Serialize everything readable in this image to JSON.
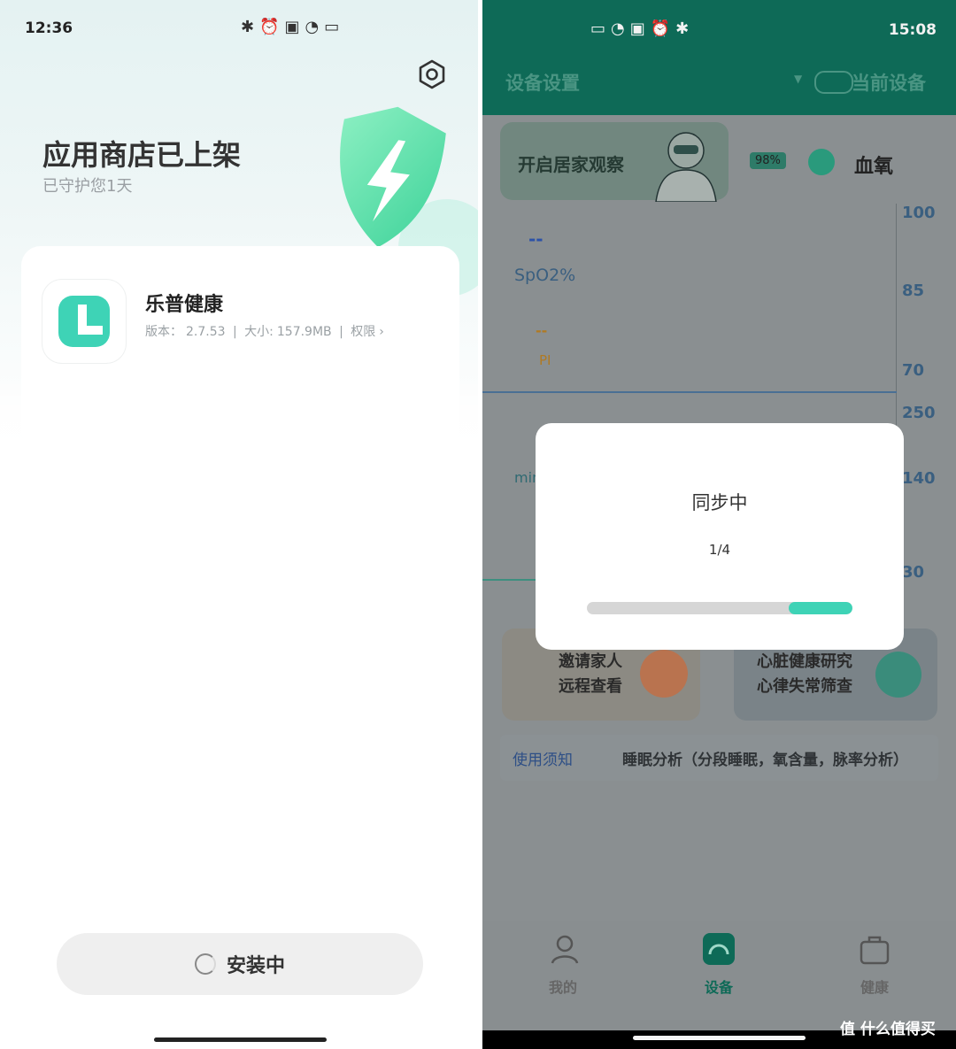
{
  "left": {
    "status_bar": {
      "time": "12:36",
      "icons": [
        "bluetooth-icon",
        "alarm-icon",
        "nfc-icon",
        "wifi-icon",
        "battery-icon"
      ],
      "battery": "31"
    },
    "hero": {
      "title": "应用商店已上架",
      "subtitle": "已守护您1天"
    },
    "app": {
      "name": "乐普健康",
      "version_label": "版本：",
      "version": "2.7.53",
      "size_label": "大小:",
      "size": "157.9MB",
      "perm_label": "权限",
      "arrow": "›"
    },
    "install_button": {
      "label": "安装中"
    },
    "colors": {
      "brand": "#3ed3b6",
      "shield": "#5ee0a8"
    }
  },
  "right": {
    "status_bar": {
      "time": "15:08"
    },
    "header": {
      "title_left": "设备设置",
      "title_right": "当前设备"
    },
    "observation": {
      "label": "开启居家观察"
    },
    "oxygen": {
      "name": "血氧",
      "battery": "98%"
    },
    "chart": {
      "ticks": [
        "100",
        "85",
        "70",
        "250",
        "140",
        "30"
      ],
      "spo2_value": "--",
      "spo2_label": "SpO2%",
      "pi_value": "--",
      "pi_label": "PI",
      "min_label": "min"
    },
    "features": [
      {
        "line1": "邀请家人",
        "line2": "远程查看"
      },
      {
        "line1": "心脏健康研究",
        "line2": "心律失常筛查"
      }
    ],
    "notice": {
      "link": "使用须知",
      "text": "睡眠分析（分段睡眠，氧含量，脉率分析）"
    },
    "tabs": [
      {
        "label": "我的",
        "icon": "profile-icon"
      },
      {
        "label": "设备",
        "icon": "device-icon"
      },
      {
        "label": "健康",
        "icon": "health-bag-icon"
      }
    ],
    "dialog": {
      "title": "同步中",
      "count": "1/4",
      "progress_fraction": 0.24
    },
    "watermark": "值 什么值得买",
    "colors": {
      "header": "#0e6a57",
      "progress": "#3ed3b6"
    }
  }
}
